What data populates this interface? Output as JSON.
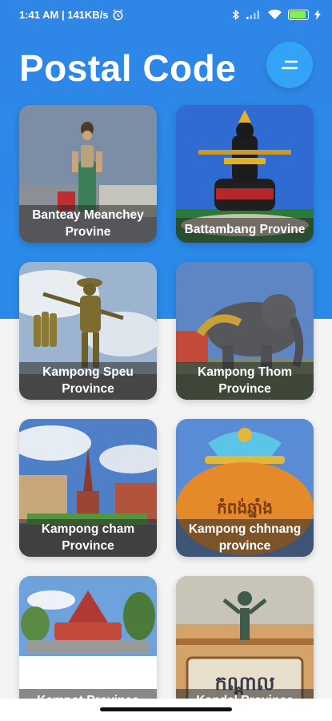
{
  "status_bar": {
    "time_speed": "1:41 AM | 141KB/s",
    "battery_level": "0.9"
  },
  "header": {
    "title": "Postal Code"
  },
  "provinces": [
    {
      "line1": "Banteay Meanchey",
      "line2": "Provine"
    },
    {
      "line1": "Battambang Provine",
      "line2": ""
    },
    {
      "line1": "Kampong Speu",
      "line2": "Province"
    },
    {
      "line1": "Kampong Thom",
      "line2": "Province"
    },
    {
      "line1": "Kampong cham",
      "line2": "Province"
    },
    {
      "line1": "Kampong chhnang",
      "line2": "province"
    },
    {
      "line1": "Kampot Province",
      "line2": ""
    },
    {
      "line1": "Kandal Province",
      "line2": ""
    }
  ],
  "images": {
    "kampong_chhnang_sign": "កំពង់ឆ្នាំង",
    "kandal_sign": "កណ្ដាល"
  },
  "colors": {
    "header_blue": "#2f86e6",
    "menu_button": "#33a3f5",
    "battery_green": "#7ef05a"
  }
}
